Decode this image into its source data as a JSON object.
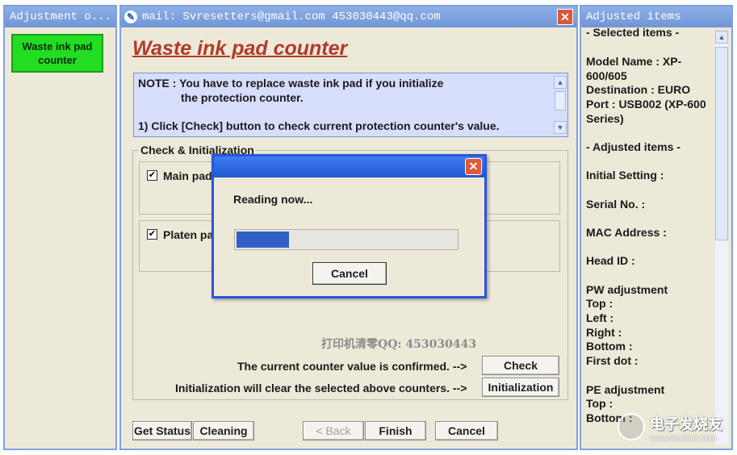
{
  "left_window": {
    "title": "Adjustment o...",
    "menu_item": "Waste ink pad counter"
  },
  "main_window": {
    "title": "mail: Svresetters@gmail.com  453030443@qq.com",
    "heading": "Waste ink pad counter",
    "note_line1": "NOTE : You have to replace waste ink pad if you initialize",
    "note_line2": "the protection counter.",
    "note_line3": "1) Click [Check] button to check current protection counter's value.",
    "group_label": "Check & Initialization",
    "main_pad_label": "Main pad",
    "platen_pad_label": "Platen pa",
    "watermark": "打印机清零QQ: 453030443",
    "confirmed_text": "The current counter value is confirmed. -->",
    "init_text": "Initialization will clear the selected above counters. -->",
    "check_button": "Check",
    "init_button": "Initialization",
    "footer": {
      "get_status": "Get Status",
      "cleaning": "Cleaning",
      "back": "< Back",
      "finish": "Finish",
      "cancel": "Cancel"
    }
  },
  "dialog": {
    "message": "Reading now...",
    "progress": 0.25,
    "cancel": "Cancel"
  },
  "right_window": {
    "title": "Adjusted items",
    "lines": [
      "- Selected items -",
      "Model Name : XP-",
      "600/605",
      "Destination : EURO",
      "Port : USB002 (XP-600",
      "Series)",
      "- Adjusted items -",
      "Initial Setting :",
      "Serial No. :",
      "MAC Address :",
      "Head ID :",
      "PW adjustment",
      "Top :",
      "Left :",
      "Right :",
      "Bottom :",
      "First dot :",
      "PE adjustment",
      "Top :",
      "Bottom :"
    ]
  },
  "watermark_logo": {
    "text": "电子发烧友",
    "url": "www.elecfans.com"
  },
  "colors": {
    "accent_green": "#22dd22",
    "titlebar_blue": "#7fa2dc",
    "close_red": "#d9583b",
    "progress_blue": "#3160c4"
  }
}
